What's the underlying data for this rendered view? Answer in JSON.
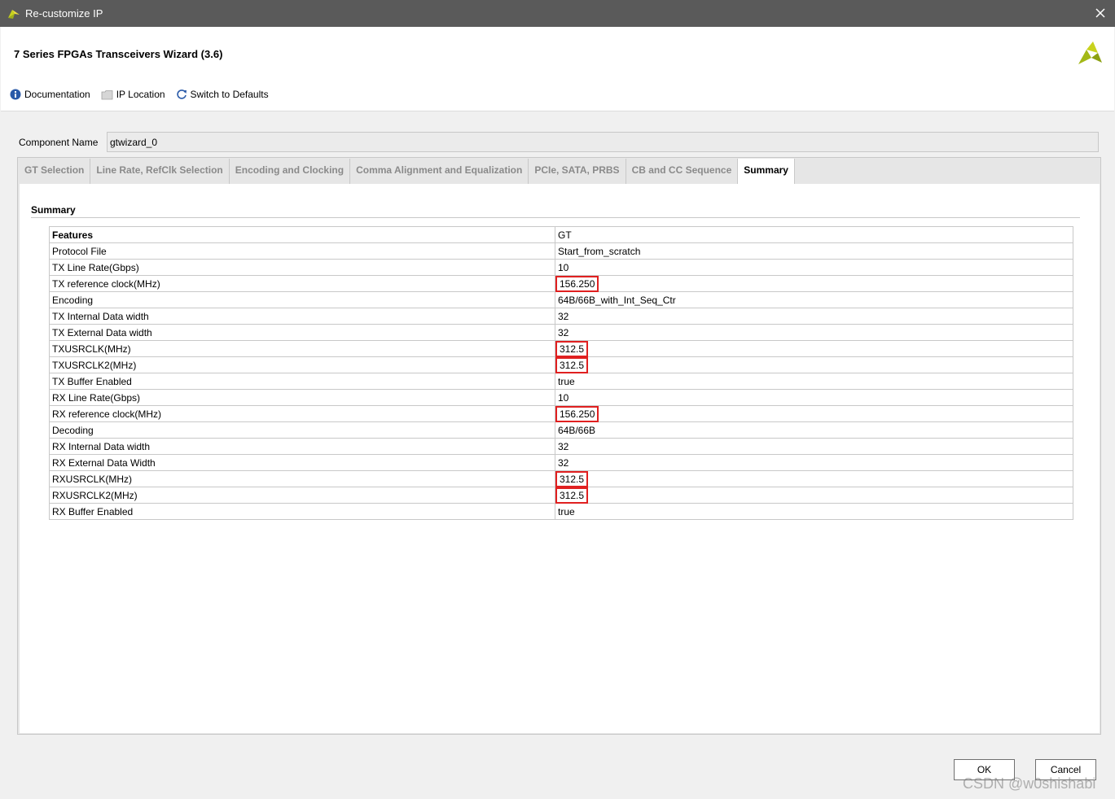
{
  "window": {
    "title": "Re-customize IP"
  },
  "header": {
    "wizard_title": "7 Series FPGAs Transceivers Wizard (3.6)"
  },
  "toolbar": {
    "documentation": "Documentation",
    "ip_location": "IP Location",
    "switch_defaults": "Switch to Defaults"
  },
  "component": {
    "label": "Component Name",
    "value": "gtwizard_0"
  },
  "tabs": [
    {
      "label": "GT Selection"
    },
    {
      "label": "Line Rate, RefClk Selection"
    },
    {
      "label": "Encoding and Clocking"
    },
    {
      "label": "Comma Alignment and Equalization"
    },
    {
      "label": "PCIe, SATA, PRBS"
    },
    {
      "label": "CB and CC Sequence"
    },
    {
      "label": "Summary"
    }
  ],
  "summary": {
    "title": "Summary",
    "header": {
      "feature": "Features",
      "value": "GT"
    },
    "rows": [
      {
        "feature": "Protocol File",
        "value": "Start_from_scratch"
      },
      {
        "feature": "TX Line Rate(Gbps)",
        "value": "10"
      },
      {
        "feature": "TX reference clock(MHz)",
        "value": "156.250"
      },
      {
        "feature": "Encoding",
        "value": "64B/66B_with_Int_Seq_Ctr"
      },
      {
        "feature": "TX Internal Data width",
        "value": "32"
      },
      {
        "feature": "TX External Data width",
        "value": "32"
      },
      {
        "feature": "TXUSRCLK(MHz)",
        "value": "312.5"
      },
      {
        "feature": "TXUSRCLK2(MHz)",
        "value": "312.5"
      },
      {
        "feature": "TX Buffer Enabled",
        "value": "true"
      },
      {
        "feature": "RX Line Rate(Gbps)",
        "value": "10"
      },
      {
        "feature": "RX reference clock(MHz)",
        "value": "156.250"
      },
      {
        "feature": "Decoding",
        "value": "64B/66B"
      },
      {
        "feature": "RX Internal Data width",
        "value": "32"
      },
      {
        "feature": "RX External Data Width",
        "value": "32"
      },
      {
        "feature": "RXUSRCLK(MHz)",
        "value": "312.5"
      },
      {
        "feature": "RXUSRCLK2(MHz)",
        "value": "312.5"
      },
      {
        "feature": "RX Buffer Enabled",
        "value": "true"
      }
    ]
  },
  "buttons": {
    "ok": "OK",
    "cancel": "Cancel"
  },
  "watermark": "CSDN @w0shishabi",
  "colors": {
    "highlight": "#e02020",
    "titlebar": "#5a5a5a",
    "logo": "#a3b816"
  }
}
